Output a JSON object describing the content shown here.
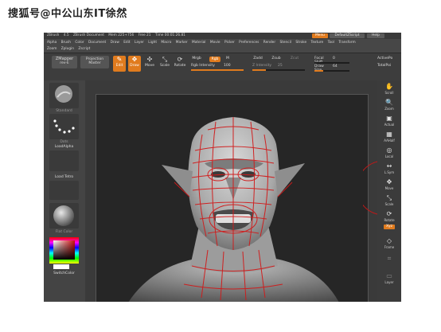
{
  "watermark": "搜狐号@中公山东IT徐然",
  "app": {
    "title_items": [
      "ZBrush",
      "4.5",
      "ZBrush Document",
      "Mem 225+756",
      "Free 21",
      "Time 00:01:26.81"
    ],
    "menu_button": "Menu",
    "script_button": "DefaultZScript",
    "help_button": "Help"
  },
  "menu_row1": [
    "Alpha",
    "Brush",
    "Color",
    "Document",
    "Draw",
    "Edit",
    "Layer",
    "Light",
    "Macro",
    "Marker",
    "Material",
    "Movie",
    "Picker",
    "Preferences",
    "Render",
    "Stencil",
    "Stroke",
    "Texture",
    "Tool",
    "Transform"
  ],
  "menu_row2": [
    "Zoom",
    "Zplugin",
    "Zscript"
  ],
  "toolbar": {
    "zmapper": "ZMapper",
    "zmapper_sub": "rev-E",
    "projection": "Projection",
    "projection_sub": "Master",
    "edit": "Edit",
    "draw": "Draw",
    "move": "Move",
    "scale": "Scale",
    "rotate": "Rotate",
    "mrgb": "Mrgb",
    "rgb": "Rgb",
    "m": "M",
    "rgb_intensity_label": "Rgb Intensity",
    "rgb_intensity": "100",
    "zadd": "Zadd",
    "zsub": "Zsub",
    "zcut": "Zcut",
    "z_intensity_label": "Z Intensity",
    "z_intensity": "25",
    "focal_shift_label": "Focal Shift",
    "focal_shift": "0",
    "draw_size_label": "Draw Size",
    "draw_size": "64",
    "active_points": "ActivePo",
    "total_points": "TotalPoi",
    "rgb_intensity_level": 1.0,
    "z_intensity_level": 0.25,
    "draw_size_level": 0.25
  },
  "left_panel": {
    "brush_label": "Standard",
    "stroke_label": "Dots",
    "alpha_label": "LoadAlpha",
    "texture_label": "Load Tetro",
    "material_label": "Flat Color",
    "switch_color": "SwitchColor"
  },
  "right_panel": [
    {
      "icon": "scroll-icon",
      "glyph": "✋",
      "label": "Scroll"
    },
    {
      "icon": "zoom-icon",
      "glyph": "🔍",
      "label": "Zoom"
    },
    {
      "icon": "actual-icon",
      "glyph": "▣",
      "label": "Actual"
    },
    {
      "icon": "aahalf-icon",
      "glyph": "▦",
      "label": "AAHalf"
    },
    {
      "icon": "local-icon",
      "glyph": "◎",
      "label": "Local"
    },
    {
      "icon": "lsym-icon",
      "glyph": "↔",
      "label": "L.Sym"
    },
    {
      "icon": "move-icon",
      "glyph": "✥",
      "label": "Move"
    },
    {
      "icon": "scale-icon",
      "glyph": "⤡",
      "label": "Scale"
    },
    {
      "icon": "rotate-icon",
      "glyph": "⟳",
      "label": "Rotate"
    },
    {
      "icon": "xyz-icon",
      "glyph": "Xyz",
      "label": ""
    },
    {
      "icon": "frame-icon",
      "glyph": "◇",
      "label": "Frame"
    },
    {
      "icon": "lasso-icon",
      "glyph": "⌗",
      "label": ""
    },
    {
      "icon": "layer-icon",
      "glyph": "▭",
      "label": "Layer"
    }
  ],
  "colors": {
    "accent": "#e07b1e",
    "topology_lines": "#d11a1a",
    "panel": "#444444",
    "canvas": "#262626"
  }
}
